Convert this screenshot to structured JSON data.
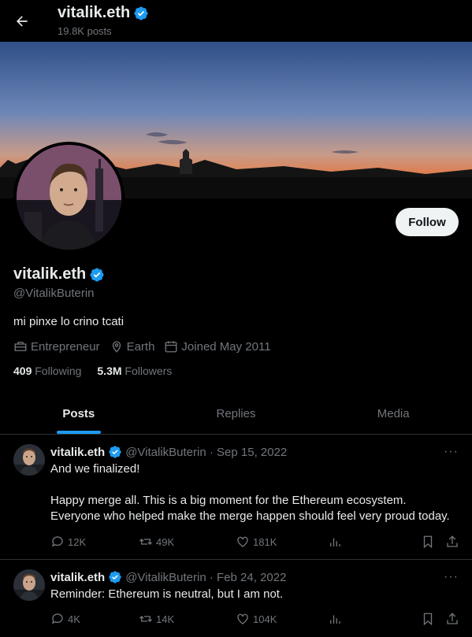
{
  "header": {
    "title": "vitalik.eth",
    "posts_count": "19.8K posts"
  },
  "profile": {
    "follow_label": "Follow",
    "name": "vitalik.eth",
    "handle": "@VitalikButerin",
    "bio": "mi pinxe lo crino tcati",
    "occupation": "Entrepreneur",
    "location": "Earth",
    "joined": "Joined May 2011",
    "following_count": "409",
    "following_label": "Following",
    "followers_count": "5.3M",
    "followers_label": "Followers"
  },
  "tabs": [
    {
      "label": "Posts",
      "active": true
    },
    {
      "label": "Replies",
      "active": false
    },
    {
      "label": "Media",
      "active": false
    }
  ],
  "posts": [
    {
      "name": "vitalik.eth",
      "handle_date": "@VitalikButerin · Sep 15, 2022",
      "lines": [
        "And we finalized!",
        "",
        "Happy merge all. This is a big moment for the Ethereum ecosystem.",
        "Everyone who helped make the merge happen should feel very proud today."
      ],
      "replies": "12K",
      "reposts": "49K",
      "likes": "181K"
    },
    {
      "name": "vitalik.eth",
      "handle_date": "@VitalikButerin · Feb 24, 2022",
      "lines": [
        "Reminder: Ethereum is neutral, but I am not."
      ],
      "replies": "4K",
      "reposts": "14K",
      "likes": "104K"
    }
  ],
  "icons": {
    "verified_color": "#1d9bf0",
    "back": "arrow-left-icon",
    "more": "more-icon"
  },
  "more_glyph": "···"
}
